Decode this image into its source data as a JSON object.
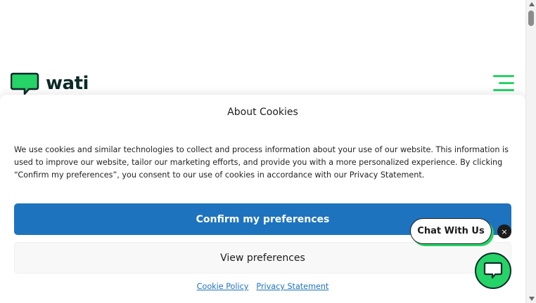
{
  "brand": {
    "name": "wati",
    "accent_color": "#25d366",
    "text_color": "#0d2a2a"
  },
  "header": {
    "logo_icon": "chat-bubble-logo-icon",
    "menu_icon": "hamburger-menu-icon"
  },
  "cookie_banner": {
    "title": "About Cookies",
    "body": "We use cookies and similar technologies to collect and process information about your use of our website. This information is used to improve our website, tailor our marketing efforts, and provide you with a more personalized experience. By clicking “Confirm my preferences”, you consent to our use of cookies in accordance with our Privacy Statement.",
    "confirm_label": "Confirm my preferences",
    "view_label": "View preferences",
    "confirm_color": "#1e73be",
    "links": {
      "cookie_policy": "Cookie Policy",
      "privacy_statement": "Privacy Statement"
    }
  },
  "chat_widget": {
    "bubble_label": "Chat With Us",
    "close_symbol": "×",
    "close_icon": "close-icon",
    "launcher_icon": "chat-icon"
  }
}
